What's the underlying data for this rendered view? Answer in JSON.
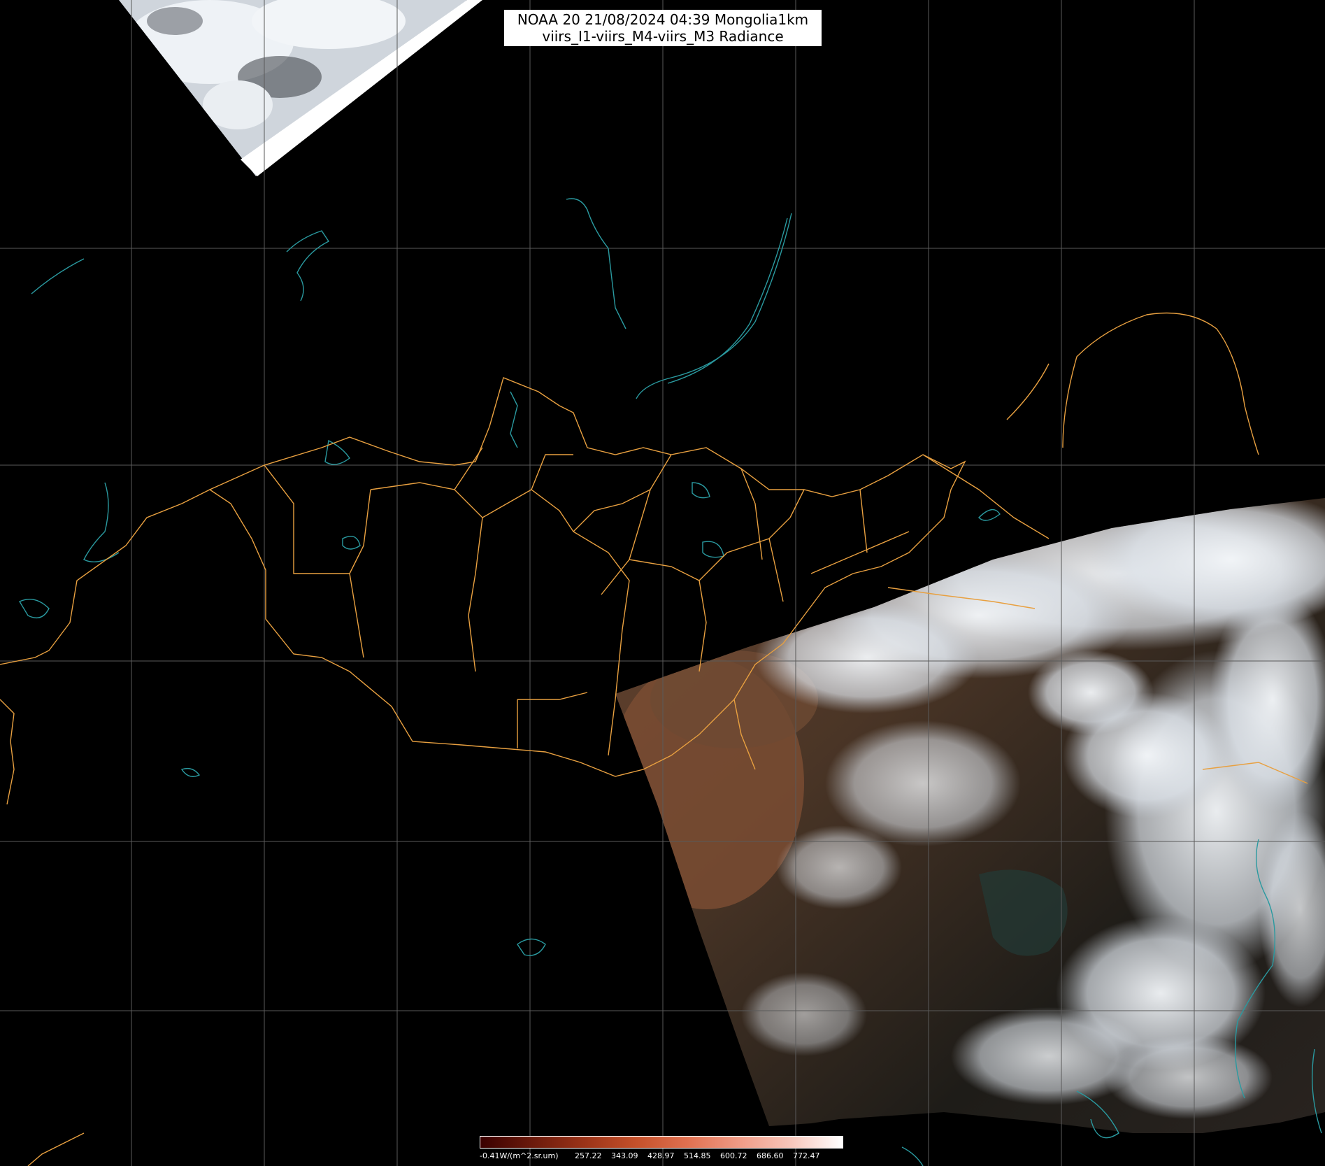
{
  "header": {
    "title_line1": "NOAA 20 21/08/2024 04:39 Mongolia1km",
    "title_line2": "viirs_I1-viirs_M4-viirs_M3 Radiance"
  },
  "legend": {
    "unit_label": "-0.41W/(m^2.sr.um)",
    "ticks": [
      "257.22",
      "343.09",
      "428.97",
      "514.85",
      "600.72",
      "686.60",
      "772.47"
    ],
    "colors": [
      "#3a0000",
      "#6b1a0c",
      "#9a3318",
      "#c4502a",
      "#e07050",
      "#f09b86",
      "#f7c6bb",
      "#ffffff"
    ]
  },
  "map": {
    "colors": {
      "background": "#000000",
      "graticule": "#5a5a5a",
      "border": "#e8a040",
      "water": "#2a9aa0",
      "cloud": "#e8eef4",
      "land": "#3b2a1e"
    }
  }
}
